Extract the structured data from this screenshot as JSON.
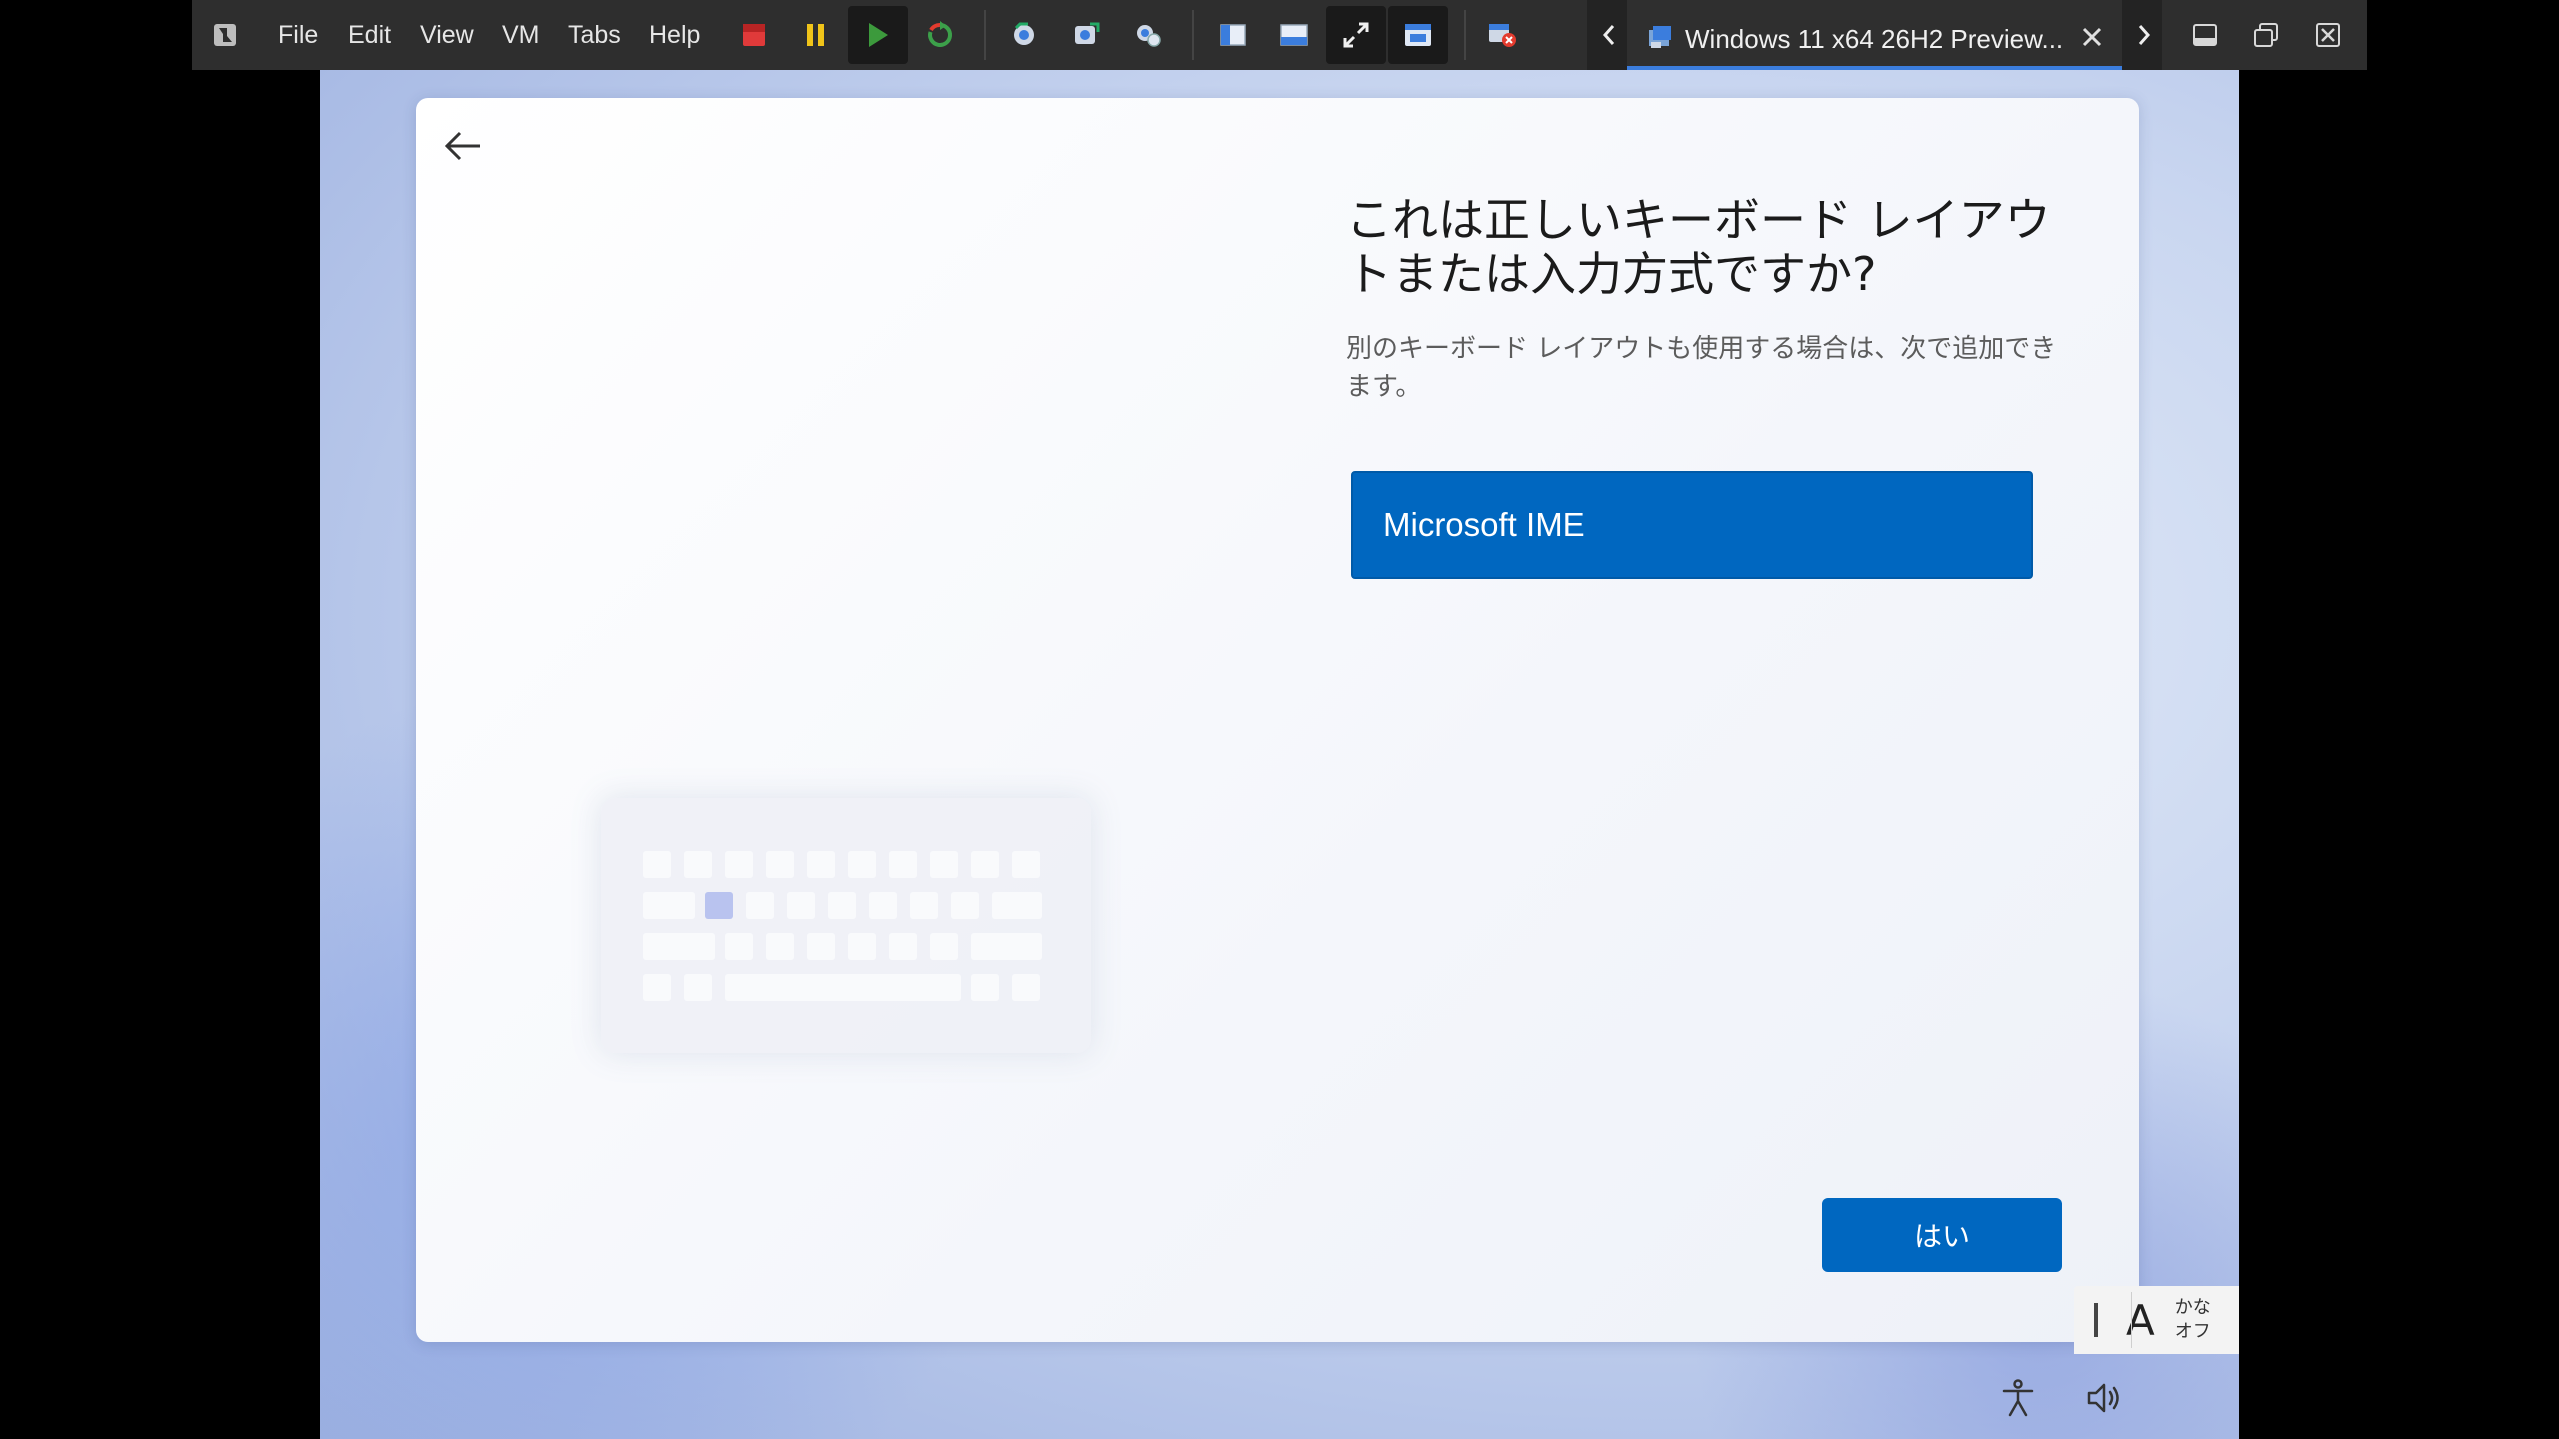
{
  "menu": {
    "file": "File",
    "edit": "Edit",
    "view": "View",
    "vm": "VM",
    "tabs": "Tabs",
    "help": "Help"
  },
  "tab": {
    "title": "Windows 11 x64 26H2 Preview..."
  },
  "oobe": {
    "headline": "これは正しいキーボード レイアウトまたは入力方式ですか?",
    "subtext": "別のキーボード レイアウトも使用する場合は、次で追加できます。",
    "selected_option": "Microsoft IME",
    "yes_button": "はい"
  },
  "ime": {
    "mode_letter": "A",
    "kana_line1": "かな",
    "kana_line2": "オフ"
  },
  "colors": {
    "accent": "#0067c0",
    "toolbar_bg": "#2e2e2e",
    "tab_underline": "#3b7ddd"
  }
}
